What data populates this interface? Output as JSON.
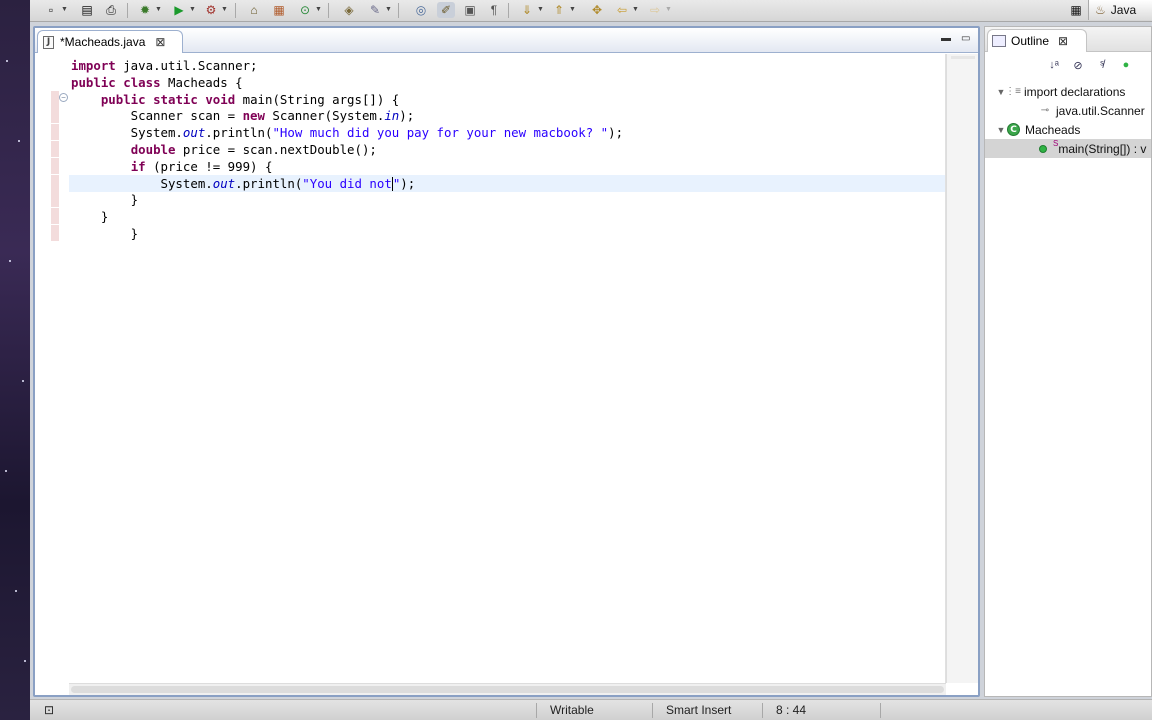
{
  "editor": {
    "tab_title": "*Macheads.java",
    "tab_icon": "J",
    "lines": [
      [
        {
          "t": "import",
          "k": "kw"
        },
        {
          "t": " java.util.Scanner;"
        }
      ],
      [
        {
          "t": "public",
          "k": "kw"
        },
        {
          "t": " "
        },
        {
          "t": "class",
          "k": "kw"
        },
        {
          "t": " Macheads {"
        }
      ],
      [
        {
          "t": "    "
        },
        {
          "t": "public",
          "k": "kw"
        },
        {
          "t": " "
        },
        {
          "t": "static",
          "k": "kw"
        },
        {
          "t": " "
        },
        {
          "t": "void",
          "k": "kw"
        },
        {
          "t": " main(String args[]) {"
        }
      ],
      [
        {
          "t": "        Scanner scan = "
        },
        {
          "t": "new",
          "k": "kw"
        },
        {
          "t": " Scanner(System."
        },
        {
          "t": "in",
          "k": "fld"
        },
        {
          "t": ");"
        }
      ],
      [
        {
          "t": "        System."
        },
        {
          "t": "out",
          "k": "fld"
        },
        {
          "t": ".println("
        },
        {
          "t": "\"How much did you pay for your new macbook? \"",
          "k": "str"
        },
        {
          "t": ");"
        }
      ],
      [
        {
          "t": "        "
        },
        {
          "t": "double",
          "k": "kw"
        },
        {
          "t": " price = scan.nextDouble();"
        }
      ],
      [
        {
          "t": "        "
        },
        {
          "t": "if",
          "k": "kw"
        },
        {
          "t": " (price != 999) {"
        }
      ],
      [
        {
          "t": "            System."
        },
        {
          "t": "out",
          "k": "fld"
        },
        {
          "t": ".println("
        },
        {
          "t": "\"You did not",
          "k": "str"
        },
        {
          "t": "",
          "caret": true
        },
        {
          "t": "\"",
          "k": "str"
        },
        {
          "t": ");"
        }
      ],
      [
        {
          "t": "        }"
        }
      ],
      [
        {
          "t": "    }"
        }
      ],
      [
        {
          "t": "        }"
        }
      ]
    ],
    "current_line_index": 7
  },
  "outline": {
    "tab_title": "Outline",
    "items": [
      {
        "label": "import declarations",
        "level": 0,
        "toggle": "▼",
        "icon": "import-icon"
      },
      {
        "label": "java.util.Scanner",
        "level": 1,
        "toggle": "",
        "icon": "import-item-icon"
      },
      {
        "label": "Macheads",
        "level": 0,
        "toggle": "▼",
        "icon": "class-icon"
      },
      {
        "label": "main(String[]) : v",
        "level": 1,
        "toggle": "",
        "icon": "method-icon",
        "selected": true
      }
    ]
  },
  "perspective": {
    "label": "Java"
  },
  "status": {
    "writable": "Writable",
    "insert_mode": "Smart Insert",
    "position": "8 : 44"
  },
  "colors": {
    "keyword": "#7f0055",
    "string": "#2a00ff",
    "field": "#0000c0",
    "current_line": "#e8f2fe"
  }
}
